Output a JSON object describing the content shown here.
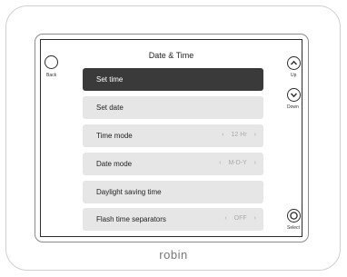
{
  "screen": {
    "title": "Date & Time",
    "items": [
      {
        "label": "Set time",
        "value": ""
      },
      {
        "label": "Set date",
        "value": ""
      },
      {
        "label": "Time mode",
        "value": "12 Hr"
      },
      {
        "label": "Date mode",
        "value": "M-D-Y"
      },
      {
        "label": "Daylight saving time",
        "value": ""
      },
      {
        "label": "Flash time separators",
        "value": "OFF"
      }
    ]
  },
  "buttons": {
    "back": "Back",
    "up": "Up",
    "down": "Down",
    "select": "Select"
  },
  "brand": "robin",
  "icons": {
    "back": "circle-button-icon",
    "up": "chevron-up-icon",
    "down": "chevron-down-icon",
    "select": "select-ring-icon",
    "value_prev": "chevron-left-icon",
    "value_next": "chevron-right-icon"
  },
  "colors": {
    "selected_bg": "#3a3a3a",
    "item_bg": "#e6e6e6",
    "value_text": "#aaaaaa"
  }
}
